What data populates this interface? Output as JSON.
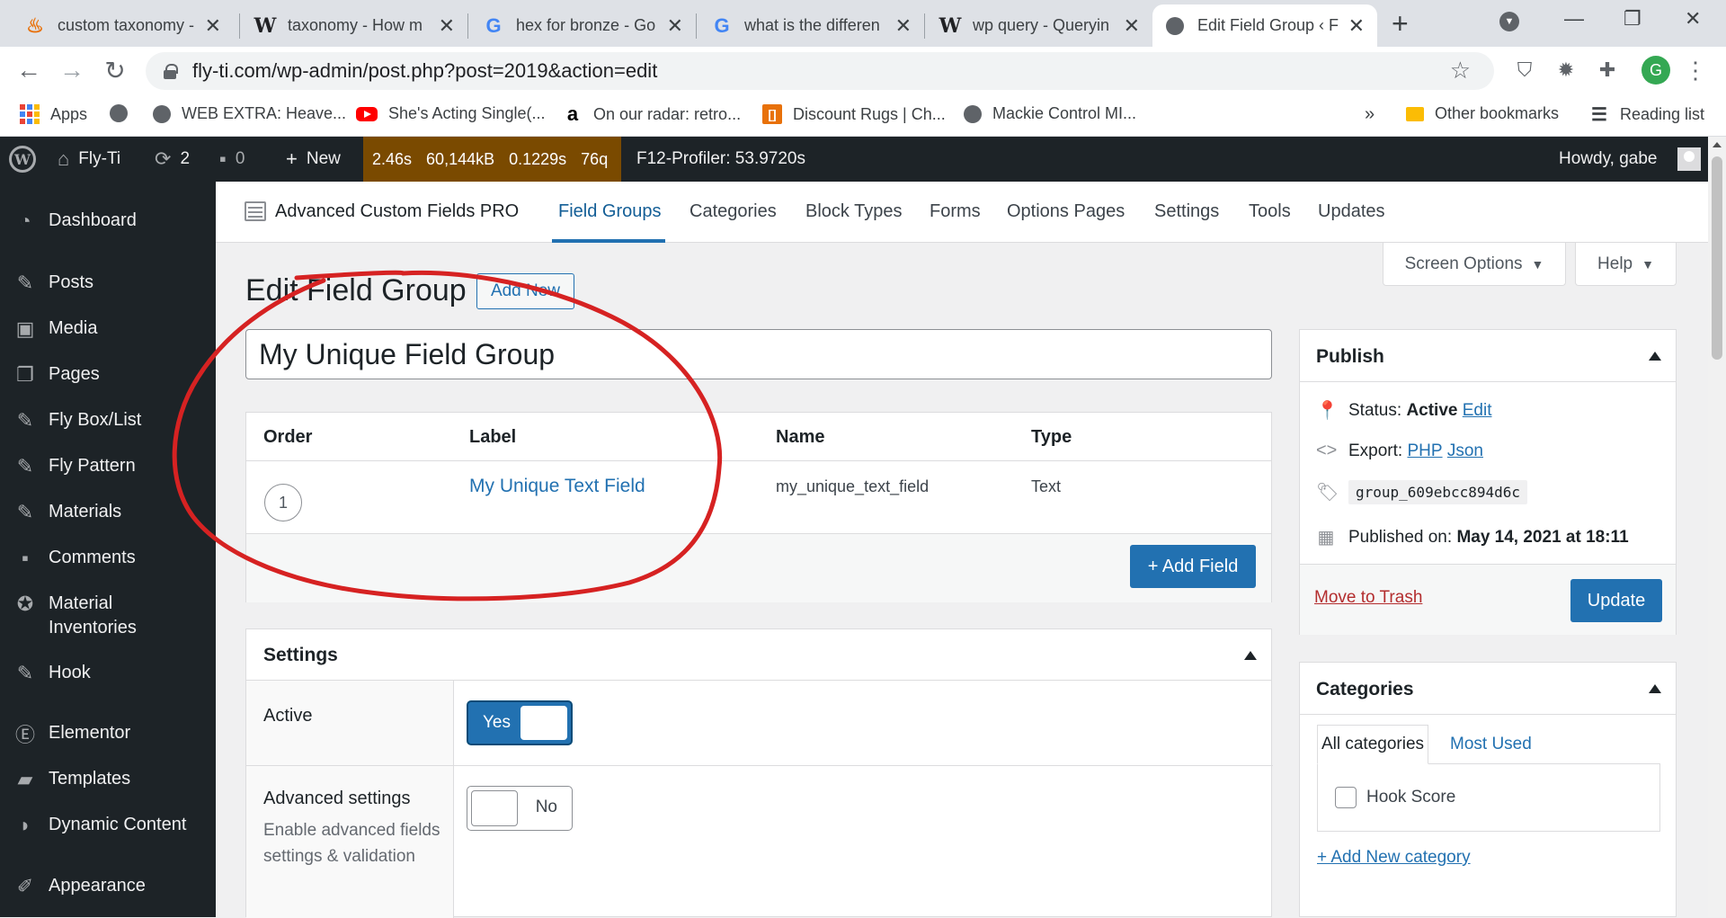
{
  "browser": {
    "tabs": [
      {
        "title": "custom taxonomy -",
        "icon": "flame-icon"
      },
      {
        "title": "taxonomy - How m",
        "icon": "wikipedia-icon"
      },
      {
        "title": "hex for bronze - Go",
        "icon": "google-icon"
      },
      {
        "title": "what is the differen",
        "icon": "google-icon"
      },
      {
        "title": "wp query - Queryin",
        "icon": "wikipedia-icon"
      },
      {
        "title": "Edit Field Group ‹ Fl",
        "icon": "globe-icon"
      }
    ],
    "url": "fly-ti.com/wp-admin/post.php?post=2019&action=edit",
    "profile_initial": "G",
    "bookmarks": [
      {
        "label": "Apps"
      },
      {
        "label": ""
      },
      {
        "label": "WEB EXTRA: Heave..."
      },
      {
        "label": "She's Acting Single(..."
      },
      {
        "label": "On our radar: retro..."
      },
      {
        "label": "Discount Rugs | Ch..."
      },
      {
        "label": "Mackie Control MI..."
      }
    ],
    "more_bookmarks": "»",
    "other_bookmarks": "Other bookmarks",
    "reading_list": "Reading list"
  },
  "adminbar": {
    "site": "Fly-Ti",
    "updates": "2",
    "comments": "0",
    "new": "New",
    "qm": [
      "2.46s",
      "60,144kB",
      "0.1229s",
      "76q"
    ],
    "profiler": "F12-Profiler: 53.9720s",
    "howdy": "Howdy, gabe"
  },
  "sidebar": {
    "items": [
      {
        "label": "Dashboard",
        "icon": "dashboard-icon"
      },
      {
        "label": "Posts",
        "icon": "pin-icon"
      },
      {
        "label": "Media",
        "icon": "media-icon"
      },
      {
        "label": "Pages",
        "icon": "pages-icon"
      },
      {
        "label": "Fly Box/List",
        "icon": "pin-icon"
      },
      {
        "label": "Fly Pattern",
        "icon": "pin-icon"
      },
      {
        "label": "Materials",
        "icon": "pin-icon"
      },
      {
        "label": "Comments",
        "icon": "comment-icon"
      },
      {
        "label": "Material Inventories",
        "icon": "award-icon"
      },
      {
        "label": "Hook",
        "icon": "pin-icon"
      },
      {
        "label": "Elementor",
        "icon": "elementor-icon"
      },
      {
        "label": "Templates",
        "icon": "folder-icon"
      },
      {
        "label": "Dynamic Content",
        "icon": "dynamic-content-icon"
      },
      {
        "label": "Appearance",
        "icon": "brush-icon"
      }
    ]
  },
  "acf": {
    "title": "Advanced Custom Fields PRO",
    "tabs": [
      "Field Groups",
      "Categories",
      "Block Types",
      "Forms",
      "Options Pages",
      "Settings",
      "Tools",
      "Updates"
    ]
  },
  "screen_options": "Screen Options",
  "help": "Help",
  "page": {
    "heading": "Edit Field Group",
    "add_new": "Add New",
    "group_title": "My Unique Field Group"
  },
  "fields": {
    "headers": [
      "Order",
      "Label",
      "Name",
      "Type"
    ],
    "rows": [
      {
        "order": "1",
        "label": "My Unique Text Field",
        "name": "my_unique_text_field",
        "type": "Text"
      }
    ],
    "add_field": "+ Add Field"
  },
  "settings": {
    "title": "Settings",
    "active_label": "Active",
    "active_value": "Yes",
    "advanced_label": "Advanced settings",
    "advanced_desc": "Enable advanced fields settings & validation",
    "advanced_value": "No"
  },
  "publish": {
    "title": "Publish",
    "status_label": "Status:",
    "status_value": "Active",
    "edit": "Edit",
    "export_label": "Export:",
    "php": "PHP",
    "json": "Json",
    "key": "group_609ebcc894d6c",
    "published_label": "Published on:",
    "published_value": "May 14, 2021 at 18:11",
    "trash": "Move to Trash",
    "update": "Update"
  },
  "categories": {
    "title": "Categories",
    "tab_all": "All categories",
    "tab_used": "Most Used",
    "items": [
      {
        "label": "Hook Score"
      }
    ],
    "add_new": "+ Add New category"
  },
  "annotation_color": "#d62222"
}
